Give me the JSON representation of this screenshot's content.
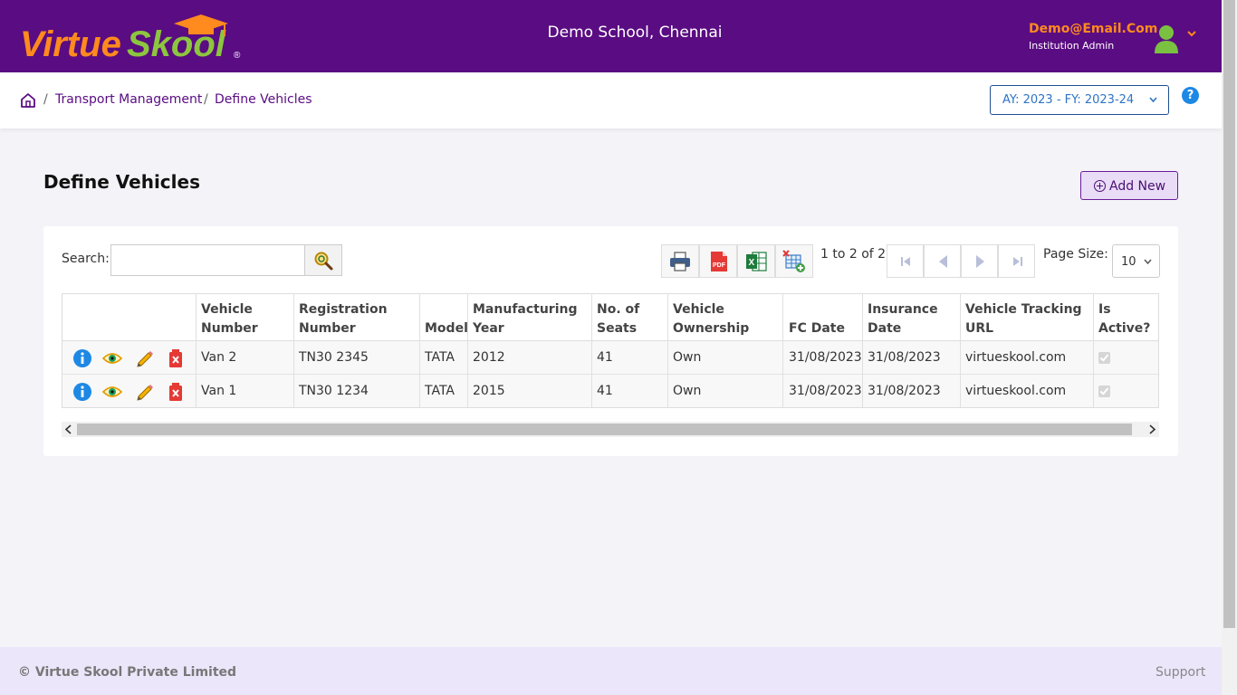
{
  "header": {
    "logo_text": "VirtueSkool",
    "school": "Demo School, Chennai",
    "user_email": "Demo@Email.Com",
    "user_role": "Institution Admin"
  },
  "breadcrumb": {
    "items": [
      "Transport Management",
      "Define Vehicles"
    ],
    "separator": "/"
  },
  "academic_year": "AY: 2023 - FY: 2023-24",
  "help_label": "?",
  "page": {
    "title": "Define Vehicles",
    "add_button": "Add New"
  },
  "toolbar": {
    "search_label": "Search:",
    "search_value": "",
    "pager_text": "1 to 2 of 2",
    "page_size_label": "Page Size:",
    "page_size": "10"
  },
  "table": {
    "headers": {
      "vehicle_number": "Vehicle Number",
      "registration_number": "Registration Number",
      "model": "Model",
      "manufacturing_year": "Manufacturing Year",
      "seats": "No. of Seats",
      "ownership": "Vehicle Ownership",
      "fc_date": "FC Date",
      "insurance_date": "Insurance Date",
      "tracking_url": "Vehicle Tracking URL",
      "is_active": "Is Active?"
    },
    "rows": [
      {
        "vehicle_number": "Van 2",
        "registration_number": "TN30 2345",
        "model": "TATA",
        "manufacturing_year": "2012",
        "seats": "41",
        "ownership": "Own",
        "fc_date": "31/08/2023",
        "insurance_date": "31/08/2023",
        "tracking_url": "virtueskool.com",
        "is_active": true
      },
      {
        "vehicle_number": "Van 1",
        "registration_number": "TN30 1234",
        "model": "TATA",
        "manufacturing_year": "2015",
        "seats": "41",
        "ownership": "Own",
        "fc_date": "31/08/2023",
        "insurance_date": "31/08/2023",
        "tracking_url": "virtueskool.com",
        "is_active": true
      }
    ]
  },
  "footer": {
    "copyright": "© Virtue Skool Private Limited",
    "support": "Support"
  },
  "colors": {
    "header_bg": "#5a0c82",
    "accent_orange": "#ff8a1e",
    "accent_green": "#8cc63f",
    "link_purple": "#5a0c82",
    "footer_bg": "#ebe6fa"
  }
}
